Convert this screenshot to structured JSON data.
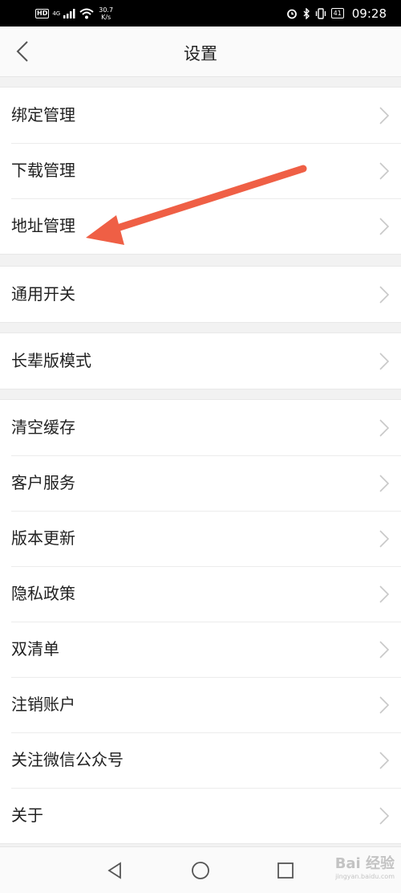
{
  "status_bar": {
    "hd": "HD",
    "network": "4G",
    "speed_value": "30.7",
    "speed_unit": "K/s",
    "battery": "41",
    "time": "09:28"
  },
  "header": {
    "title": "设置"
  },
  "groups": [
    {
      "items": [
        {
          "label": "绑定管理"
        },
        {
          "label": "下载管理"
        },
        {
          "label": "地址管理"
        }
      ]
    },
    {
      "items": [
        {
          "label": "通用开关"
        }
      ]
    },
    {
      "items": [
        {
          "label": "长辈版模式"
        }
      ]
    },
    {
      "items": [
        {
          "label": "清空缓存"
        },
        {
          "label": "客户服务"
        },
        {
          "label": "版本更新"
        },
        {
          "label": "隐私政策"
        },
        {
          "label": "双清单"
        },
        {
          "label": "注销账户"
        },
        {
          "label": "关注微信公众号"
        },
        {
          "label": "关于"
        }
      ]
    }
  ],
  "watermark": {
    "text": "Bai 经验",
    "sub": "jingyan.baidu.com"
  },
  "colors": {
    "annotation_arrow": "#ef5f45",
    "background": "#f2f2f2"
  }
}
